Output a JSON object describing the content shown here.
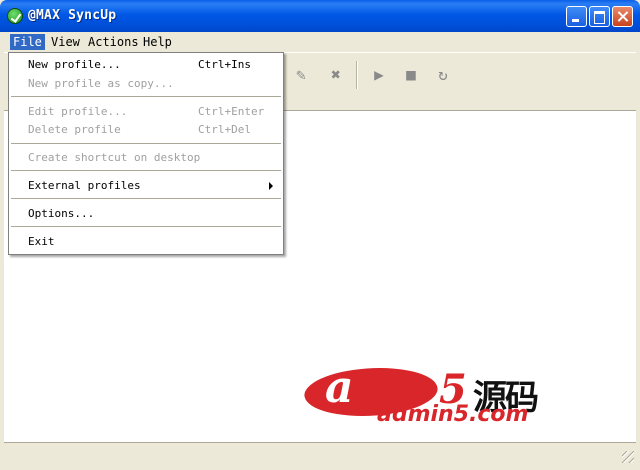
{
  "window": {
    "title": "@MAX SyncUp"
  },
  "menubar": {
    "items": [
      "File",
      "View",
      "Actions",
      "Help"
    ]
  },
  "file_menu": {
    "new_profile": {
      "label": "New profile...",
      "shortcut": "Ctrl+Ins"
    },
    "new_profile_copy": {
      "label": "New profile as copy..."
    },
    "edit_profile": {
      "label": "Edit profile...",
      "shortcut": "Ctrl+Enter"
    },
    "delete_profile": {
      "label": "Delete profile",
      "shortcut": "Ctrl+Del"
    },
    "create_shortcut": {
      "label": "Create shortcut on desktop"
    },
    "external_profiles": {
      "label": "External profiles"
    },
    "options": {
      "label": "Options..."
    },
    "exit": {
      "label": "Exit"
    }
  },
  "toolbar": {
    "icons": [
      "wand-icon",
      "delete-icon",
      "play-icon",
      "stop-icon",
      "refresh-icon"
    ]
  },
  "watermark": {
    "logo_letter": "a",
    "logo_digit": "5",
    "logo_chinese": "源码",
    "logo_url": "admin5.com"
  },
  "colors": {
    "titlebar": "#0058E6",
    "menu_highlight": "#316AC5",
    "window_face": "#ECE9D8",
    "logo_red": "#D8262A"
  }
}
